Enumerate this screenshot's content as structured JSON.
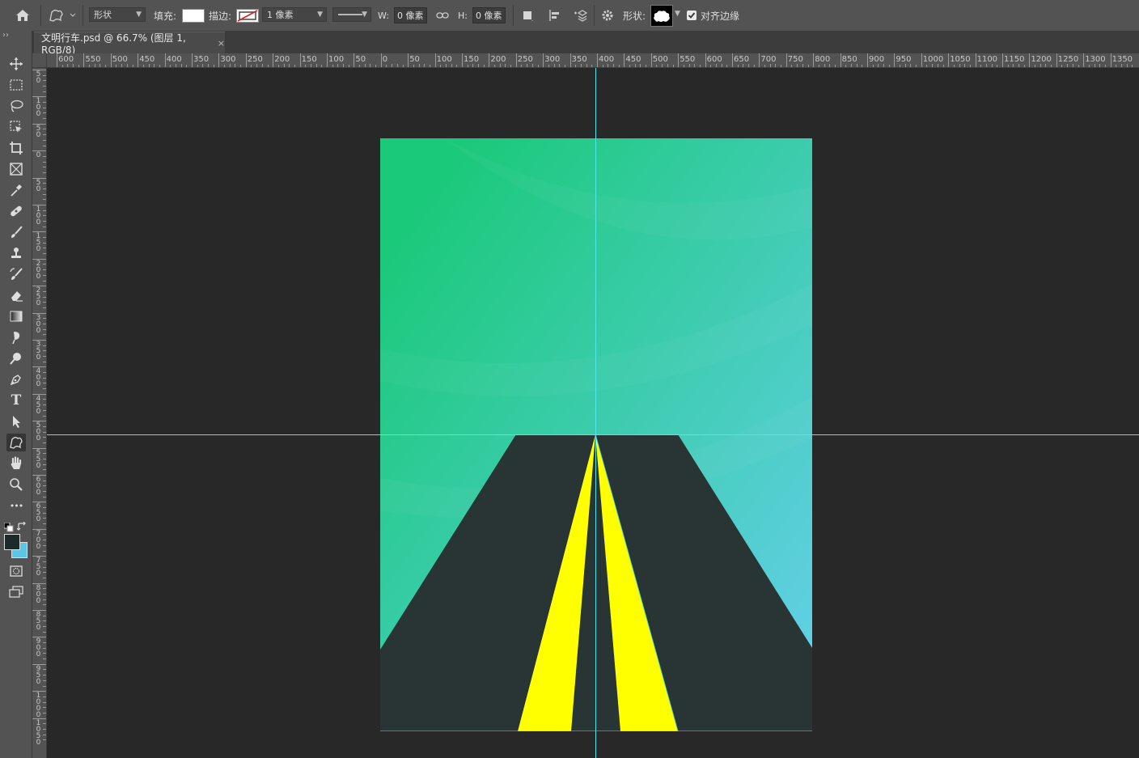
{
  "options_bar": {
    "mode_value": "形状",
    "fill_label": "填充:",
    "stroke_label": "描边:",
    "stroke_width_value": "1 像素",
    "width_label": "W:",
    "width_value": "0 像素",
    "height_label": "H:",
    "height_value": "0 像素",
    "shape_label": "形状:",
    "align_edges_label": "对齐边缘",
    "align_edges_checked": true
  },
  "document_tab": {
    "title": "文明行车.psd @ 66.7% (图层 1, RGB/8)",
    "close_glyph": "×"
  },
  "collapse_glyph": "››",
  "ruler_top_labels": [
    "600",
    "550",
    "500",
    "450",
    "400",
    "350",
    "300",
    "250",
    "200",
    "150",
    "100",
    "50",
    "0",
    "50",
    "100",
    "150",
    "200",
    "250",
    "300",
    "350",
    "400",
    "450",
    "500",
    "550",
    "600",
    "650",
    "700",
    "750",
    "800",
    "850",
    "900",
    "950",
    "1000",
    "1050",
    "1100",
    "1150",
    "1200",
    "1250",
    "1300",
    "1350"
  ],
  "ruler_left_labels": [
    "50",
    "100",
    "50",
    "0",
    "50",
    "100",
    "150",
    "200",
    "250",
    "300",
    "350",
    "400",
    "450",
    "500",
    "550",
    "600",
    "650",
    "700",
    "750",
    "800",
    "850",
    "900",
    "950",
    "1000",
    "1050"
  ],
  "toolbox": {
    "tools": [
      "move-tool",
      "marquee-tool",
      "lasso-tool",
      "object-select-tool",
      "crop-tool",
      "frame-tool",
      "eyedropper-tool",
      "healing-brush-tool",
      "brush-tool",
      "clone-stamp-tool",
      "history-brush-tool",
      "eraser-tool",
      "gradient-tool",
      "blur-tool",
      "dodge-tool",
      "pen-tool",
      "type-tool",
      "path-select-tool",
      "custom-shape-tool",
      "hand-tool",
      "zoom-tool",
      "more-tools"
    ],
    "active_tool": "custom-shape-tool",
    "type_tool_glyph": "T",
    "more_glyph": "•••",
    "foreground_color": "#1c2b2a",
    "background_color": "#5bc6e6"
  },
  "canvas": {
    "sky_gradient_start": "#1bc97a",
    "sky_gradient_end": "#67d0ee",
    "road_color": "#283534",
    "stripe_color": "#ffff00",
    "guide_color": "#4fe7ef"
  }
}
